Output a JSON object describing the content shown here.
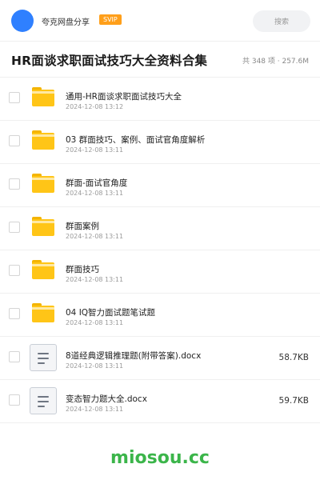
{
  "header": {
    "user_name": "夸克网盘分享",
    "badge": "SVIP",
    "search_label": "搜索"
  },
  "share": {
    "title": "HR面谈求职面试技巧大全资料合集",
    "meta": "共 348 项 · 257.6M"
  },
  "files": [
    {
      "type": "folder",
      "name": "通用-HR面谈求职面试技巧大全",
      "date": "2024-12-08 13:12",
      "size": ""
    },
    {
      "type": "folder",
      "name": "03 群面技巧、案例、面试官角度解析",
      "date": "2024-12-08 13:11",
      "size": ""
    },
    {
      "type": "folder",
      "name": "群面-面试官角度",
      "date": "2024-12-08 13:11",
      "size": ""
    },
    {
      "type": "folder",
      "name": "群面案例",
      "date": "2024-12-08 13:11",
      "size": ""
    },
    {
      "type": "folder",
      "name": "群面技巧",
      "date": "2024-12-08 13:11",
      "size": ""
    },
    {
      "type": "folder",
      "name": "04 IQ智力面试题笔试题",
      "date": "2024-12-08 13:11",
      "size": ""
    },
    {
      "type": "doc",
      "name": "8道经典逻辑推理题(附带答案).docx",
      "date": "2024-12-08 13:11",
      "size": "58.7KB"
    },
    {
      "type": "doc",
      "name": "变态智力题大全.docx",
      "date": "2024-12-08 13:11",
      "size": "59.7KB"
    }
  ],
  "watermark": "miosou.cc",
  "colors": {
    "avatar": "#2f80ff",
    "badge": "#ff9f1a",
    "folder": "#ffc517",
    "watermark": "#3bb54a"
  }
}
